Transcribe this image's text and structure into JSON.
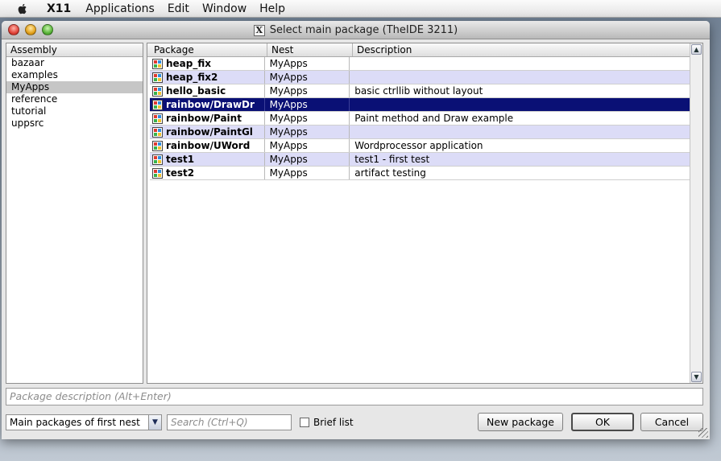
{
  "menubar": {
    "app_name": "X11",
    "items": [
      "Applications",
      "Edit",
      "Window",
      "Help"
    ]
  },
  "window": {
    "title": "Select main package (TheIDE 3211)"
  },
  "assembly": {
    "header": "Assembly",
    "items": [
      "bazaar",
      "examples",
      "MyApps",
      "reference",
      "tutorial",
      "uppsrc"
    ],
    "selected": "MyApps"
  },
  "packages": {
    "columns": [
      "Package",
      "Nest",
      "Description"
    ],
    "rows": [
      {
        "package": "heap_fix",
        "nest": "MyApps",
        "description": "",
        "state": "normal"
      },
      {
        "package": "heap_fix2",
        "nest": "MyApps",
        "description": "",
        "state": "alt"
      },
      {
        "package": "hello_basic",
        "nest": "MyApps",
        "description": "basic ctrllib without layout",
        "state": "normal"
      },
      {
        "package": "rainbow/DrawDr",
        "nest": "MyApps",
        "description": "",
        "state": "selected"
      },
      {
        "package": "rainbow/Paint",
        "nest": "MyApps",
        "description": "Paint method and Draw example",
        "state": "normal"
      },
      {
        "package": "rainbow/PaintGl",
        "nest": "MyApps",
        "description": "",
        "state": "alt"
      },
      {
        "package": "rainbow/UWord",
        "nest": "MyApps",
        "description": "Wordprocessor application",
        "state": "normal"
      },
      {
        "package": "test1",
        "nest": "MyApps",
        "description": "test1 - first test",
        "state": "alt"
      },
      {
        "package": "test2",
        "nest": "MyApps",
        "description": "artifact testing",
        "state": "normal"
      }
    ]
  },
  "description_placeholder": "Package description (Alt+Enter)",
  "filter": {
    "selected": "Main packages of first nest"
  },
  "search": {
    "placeholder": "Search (Ctrl+Q)"
  },
  "brief_list": {
    "label": "Brief list",
    "checked": false
  },
  "buttons": {
    "new_package": "New package",
    "ok": "OK",
    "cancel": "Cancel"
  },
  "colors": {
    "selection": "#0a1075",
    "alt_row": "#dcdcf7",
    "assembly_selection": "#c6c6c6"
  }
}
